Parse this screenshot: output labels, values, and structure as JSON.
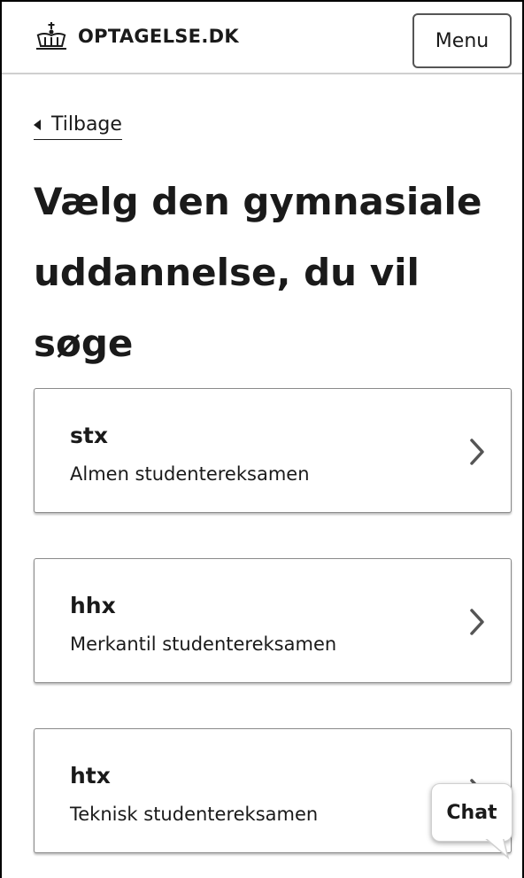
{
  "header": {
    "logo_text": "OPTAGELSE.DK",
    "menu_label": "Menu"
  },
  "nav": {
    "back_label": "Tilbage"
  },
  "page": {
    "title": "Vælg den gymnasiale uddannelse, du vil søge"
  },
  "education_options": [
    {
      "code": "stx",
      "description": "Almen studentereksamen"
    },
    {
      "code": "hhx",
      "description": "Merkantil studentereksamen"
    },
    {
      "code": "htx",
      "description": "Teknisk studentereksamen"
    }
  ],
  "chat": {
    "label": "Chat"
  },
  "icons": {
    "logo": "crown-icon",
    "back": "caret-left-icon",
    "card": "chevron-right-icon"
  }
}
